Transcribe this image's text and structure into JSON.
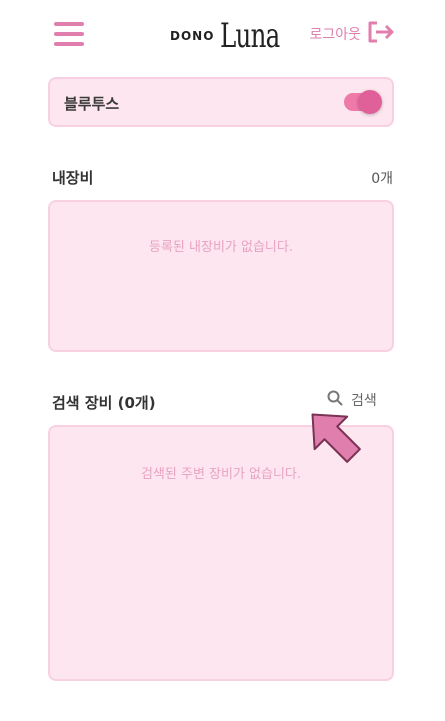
{
  "header": {
    "logo_prefix": "DONO",
    "logo_name": "Luna",
    "logout_label": "로그아웃"
  },
  "bluetooth": {
    "label": "블루투스",
    "enabled": true
  },
  "my_devices": {
    "title": "내장비",
    "count": "0개",
    "empty_message": "등록된 내장비가 없습니다."
  },
  "search_devices": {
    "title": "검색 장비 (0개)",
    "search_label": "검색",
    "empty_message": "검색된 주변 장비가 없습니다."
  },
  "colors": {
    "accent": "#e07fae",
    "card_bg": "#fde6ef",
    "card_border": "#f8d0e1"
  },
  "icons": {
    "menu": "hamburger-menu-icon",
    "logout": "logout-icon",
    "search": "search-icon",
    "pointer": "arrow-pointer-icon"
  }
}
